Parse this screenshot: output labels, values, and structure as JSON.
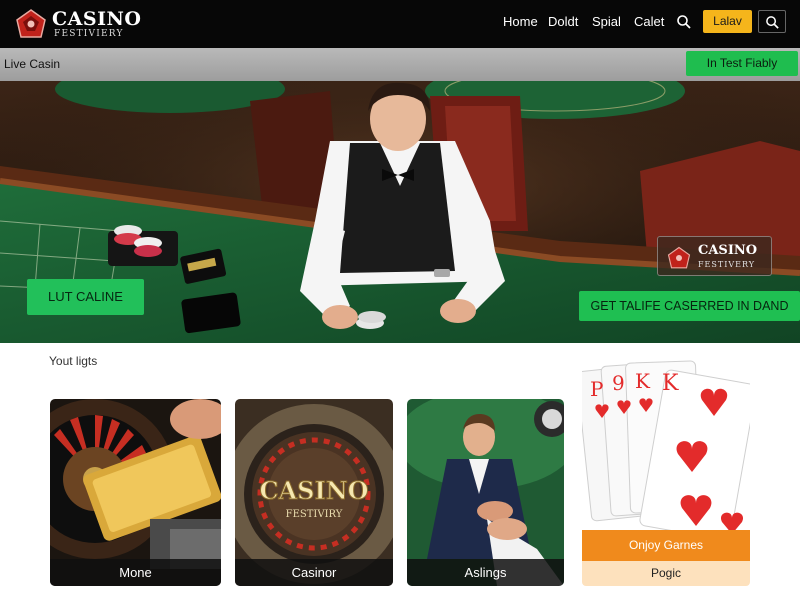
{
  "header": {
    "logo_title": "CASINO",
    "logo_subtitle": "FESTIVIERY",
    "nav": [
      {
        "label": "Home"
      },
      {
        "label": "Doldt"
      },
      {
        "label": "Spial"
      },
      {
        "label": "Calet"
      }
    ],
    "login_label": "Lalav",
    "icons": [
      "search-icon"
    ]
  },
  "live_bar": {
    "label": "Live Casin",
    "button_label": "In Test Fiably"
  },
  "hero": {
    "cta_left": "LUT CALINE",
    "cta_right": "GET TALIFE CASERRED IN DAND",
    "badge_title": "CASINO",
    "badge_subtitle": "FESTIVERY"
  },
  "section": {
    "title": "Yout ligts"
  },
  "cards": [
    {
      "label": "Mone"
    },
    {
      "label": "Casinor"
    },
    {
      "label": "Aslings"
    }
  ],
  "chip_text": "CASINO",
  "chip_subtext": "FESTIVIRY",
  "promo": {
    "button_label": "Onjoy Garnes",
    "sub_label": "Pogic",
    "cards": [
      "P",
      "9",
      "K",
      "K"
    ]
  },
  "colors": {
    "header_bg": "#070707",
    "accent_green": "#22c05a",
    "accent_yellow": "#f5b51b",
    "accent_orange": "#f08a1c",
    "card_red": "#e32b2b"
  }
}
